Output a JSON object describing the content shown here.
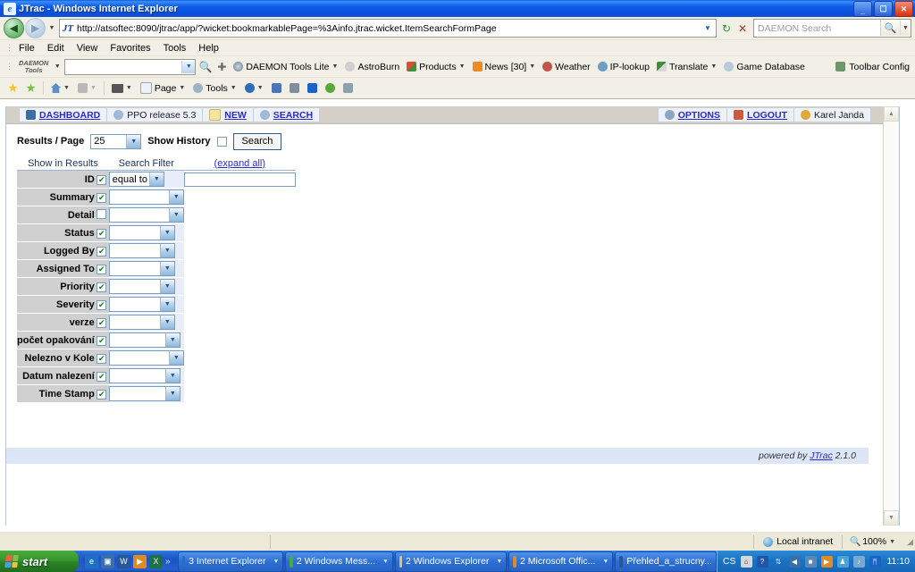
{
  "window": {
    "title": "JTrac - Windows Internet Explorer",
    "app_icon": "ie-icon",
    "minimize_label": "_",
    "maximize_label": "❐",
    "close_label": "✕"
  },
  "address_bar": {
    "back_label": "◀",
    "forward_label": "▶",
    "history_caret": "▼",
    "site_icon": "jtrac-icon",
    "url": "http://atsoftec:8090/jtrac/app/?wicket:bookmarkablePage=%3Ainfo.jtrac.wicket.ItemSearchFormPage",
    "dropdown_caret": "▼",
    "refresh_icon": "refresh-icon",
    "stop_icon": "stop-icon",
    "search_placeholder": "DAEMON Search",
    "search_value": "",
    "search_icon": "magnifier-icon",
    "search_caret": "▼"
  },
  "menu_bar": {
    "items": [
      "File",
      "Edit",
      "View",
      "Favorites",
      "Tools",
      "Help"
    ]
  },
  "daemon_toolbar": {
    "logo_line1": "DAEMON",
    "logo_line2": "Tools",
    "logo_caret": "▼",
    "search_value": "",
    "search_caret": "▼",
    "go_icon": "search-go-icon",
    "highlight_icon": "highlight-icon",
    "items": [
      {
        "label": "DAEMON Tools Lite",
        "icon": "daemon-icon",
        "caret": "▼"
      },
      {
        "label": "AstroBurn",
        "icon": "astroburn-icon",
        "caret": ""
      },
      {
        "label": "Products",
        "icon": "products-icon",
        "caret": "▼"
      },
      {
        "label": "News [30]",
        "icon": "rss-icon",
        "caret": "▼"
      },
      {
        "label": "Weather",
        "icon": "weather-icon",
        "caret": ""
      },
      {
        "label": "IP-lookup",
        "icon": "ip-icon",
        "caret": ""
      },
      {
        "label": "Translate",
        "icon": "translate-icon",
        "caret": "▼"
      },
      {
        "label": "Game Database",
        "icon": "game-icon",
        "caret": ""
      }
    ],
    "config_label": "Toolbar Config",
    "config_icon": "wrench-icon"
  },
  "command_bar": {
    "favorites_icon": "star-gold-icon",
    "addfav_icon": "star-green-icon",
    "home_label": "",
    "home_icon": "home-icon",
    "feeds_icon": "rss-icon",
    "print_icon": "printer-icon",
    "page_label": "Page",
    "page_icon": "page-icon",
    "tools_label": "Tools",
    "tools_icon": "gear-icon",
    "help_icon": "help-icon",
    "extra_icons": [
      "translate-icon",
      "snapshot-icon",
      "bluetooth-icon",
      "addon-icon",
      "script-icon"
    ],
    "caret": "▼"
  },
  "jtrac": {
    "nav_left": [
      {
        "label": "DASHBOARD",
        "icon": "dashboard-icon",
        "link": true,
        "icon_color": "#3a6ea5"
      },
      {
        "label": "PPO release 5.3",
        "icon": "space-icon",
        "link": false,
        "icon_color": "#9fb9d6"
      },
      {
        "label": "NEW",
        "icon": "new-doc-icon",
        "link": true,
        "icon_color": "#f3e4a0"
      },
      {
        "label": "SEARCH",
        "icon": "search-icon",
        "link": true,
        "icon_color": "#9fb9d6"
      }
    ],
    "nav_right": [
      {
        "label": "OPTIONS",
        "icon": "gear-icon",
        "link": true,
        "icon_color": "#8ba7c4"
      },
      {
        "label": "LOGOUT",
        "icon": "logout-icon",
        "link": true,
        "icon_color": "#d05a3a"
      },
      {
        "label": "Karel Janda",
        "icon": "user-icon",
        "link": false,
        "icon_color": "#e0a93c"
      }
    ],
    "toolbar": {
      "results_label": "Results / Page",
      "results_value": "25",
      "history_label": "Show History",
      "history_checked": false,
      "search_button": "Search",
      "caret": "▼"
    },
    "table": {
      "header_show": "Show in Results",
      "header_filter": "Search Filter",
      "header_expand": "(expand all)",
      "rows": [
        {
          "label": "ID",
          "checked": true,
          "filter": "equal to",
          "filter_width": 62,
          "has_text_input": true,
          "text_value": "",
          "input_width": 125
        },
        {
          "label": "Summary",
          "checked": true,
          "filter": "",
          "filter_width": 84,
          "has_text_input": false,
          "text_value": "",
          "input_width": 0
        },
        {
          "label": "Detail",
          "checked": false,
          "filter": "",
          "filter_width": 84,
          "has_text_input": false,
          "text_value": "",
          "input_width": 0
        },
        {
          "label": "Status",
          "checked": true,
          "filter": "",
          "filter_width": 74,
          "has_text_input": false,
          "text_value": "",
          "input_width": 0
        },
        {
          "label": "Logged By",
          "checked": true,
          "filter": "",
          "filter_width": 74,
          "has_text_input": false,
          "text_value": "",
          "input_width": 0
        },
        {
          "label": "Assigned To",
          "checked": true,
          "filter": "",
          "filter_width": 74,
          "has_text_input": false,
          "text_value": "",
          "input_width": 0
        },
        {
          "label": "Priority",
          "checked": true,
          "filter": "",
          "filter_width": 74,
          "has_text_input": false,
          "text_value": "",
          "input_width": 0
        },
        {
          "label": "Severity",
          "checked": true,
          "filter": "",
          "filter_width": 74,
          "has_text_input": false,
          "text_value": "",
          "input_width": 0
        },
        {
          "label": "verze",
          "checked": true,
          "filter": "",
          "filter_width": 74,
          "has_text_input": false,
          "text_value": "",
          "input_width": 0
        },
        {
          "label": "počet opakování",
          "checked": true,
          "filter": "",
          "filter_width": 80,
          "has_text_input": false,
          "text_value": "",
          "input_width": 0
        },
        {
          "label": "Nelezno v Kole",
          "checked": true,
          "filter": "",
          "filter_width": 84,
          "has_text_input": false,
          "text_value": "",
          "input_width": 0
        },
        {
          "label": "Datum nalezení",
          "checked": true,
          "filter": "",
          "filter_width": 80,
          "has_text_input": false,
          "text_value": "",
          "input_width": 0
        },
        {
          "label": "Time Stamp",
          "checked": true,
          "filter": "",
          "filter_width": 80,
          "has_text_input": false,
          "text_value": "",
          "input_width": 0
        }
      ]
    },
    "footer": {
      "powered_prefix": "powered by ",
      "powered_link": "JTrac",
      "powered_version": " 2.1.0"
    },
    "scrollbar": {
      "up": "▲",
      "down": "▼"
    }
  },
  "status_bar": {
    "zone_label": "Local intranet",
    "zone_icon": "globe-icon",
    "zoom_label": "100%",
    "zoom_icon": "magnifier-plus-icon",
    "zoom_caret": "▼",
    "grip": "◢"
  },
  "taskbar": {
    "start_label": "start",
    "quick_launch": [
      {
        "name": "ie-icon",
        "glyph": "e",
        "color": "#1f6fc4"
      },
      {
        "name": "desktop-icon",
        "glyph": "▣",
        "color": "#3b6ea8"
      },
      {
        "name": "word-icon",
        "glyph": "W",
        "color": "#2a5699"
      },
      {
        "name": "media-icon",
        "glyph": "▶",
        "color": "#e08a22"
      },
      {
        "name": "excel-icon",
        "glyph": "X",
        "color": "#1e7145"
      }
    ],
    "quick_more": "»",
    "tasks": [
      {
        "label": "3 Internet Explorer",
        "icon": "ie-icon",
        "icon_color": "#1f6fc4",
        "caret": "▼"
      },
      {
        "label": "2 Windows Mess...",
        "icon": "messenger-icon",
        "icon_color": "#4aab3d",
        "caret": "▼"
      },
      {
        "label": "2 Windows Explorer",
        "icon": "folder-icon",
        "icon_color": "#e8c15f",
        "caret": "▼"
      },
      {
        "label": "2 Microsoft Offic...",
        "icon": "outlook-icon",
        "icon_color": "#e08a22",
        "caret": "▼"
      },
      {
        "label": "Přehled_a_strucny...",
        "icon": "word-icon",
        "icon_color": "#2a5699",
        "caret": ""
      }
    ],
    "tray": {
      "language": "CS",
      "icons": [
        {
          "name": "keyboard-icon",
          "glyph": "⌨",
          "color": "#d8d8d8"
        },
        {
          "name": "help-icon",
          "glyph": "?",
          "color": "#2255aa"
        },
        {
          "name": "updown-icon",
          "glyph": "⇅",
          "color": "#cccccc"
        },
        {
          "name": "shield-icon",
          "glyph": "◀",
          "color": "#3a6ea5"
        },
        {
          "name": "network-icon",
          "glyph": "■",
          "color": "#5a86b8"
        },
        {
          "name": "media-icon",
          "glyph": "▶",
          "color": "#e08a22"
        },
        {
          "name": "person-icon",
          "glyph": "♟",
          "color": "#49a3d8"
        },
        {
          "name": "volume-icon",
          "glyph": "♪",
          "color": "#7aa9cf"
        },
        {
          "name": "bluetooth-icon",
          "glyph": "ᛗ",
          "color": "#1b63c7"
        }
      ],
      "clock": "11:10"
    }
  }
}
